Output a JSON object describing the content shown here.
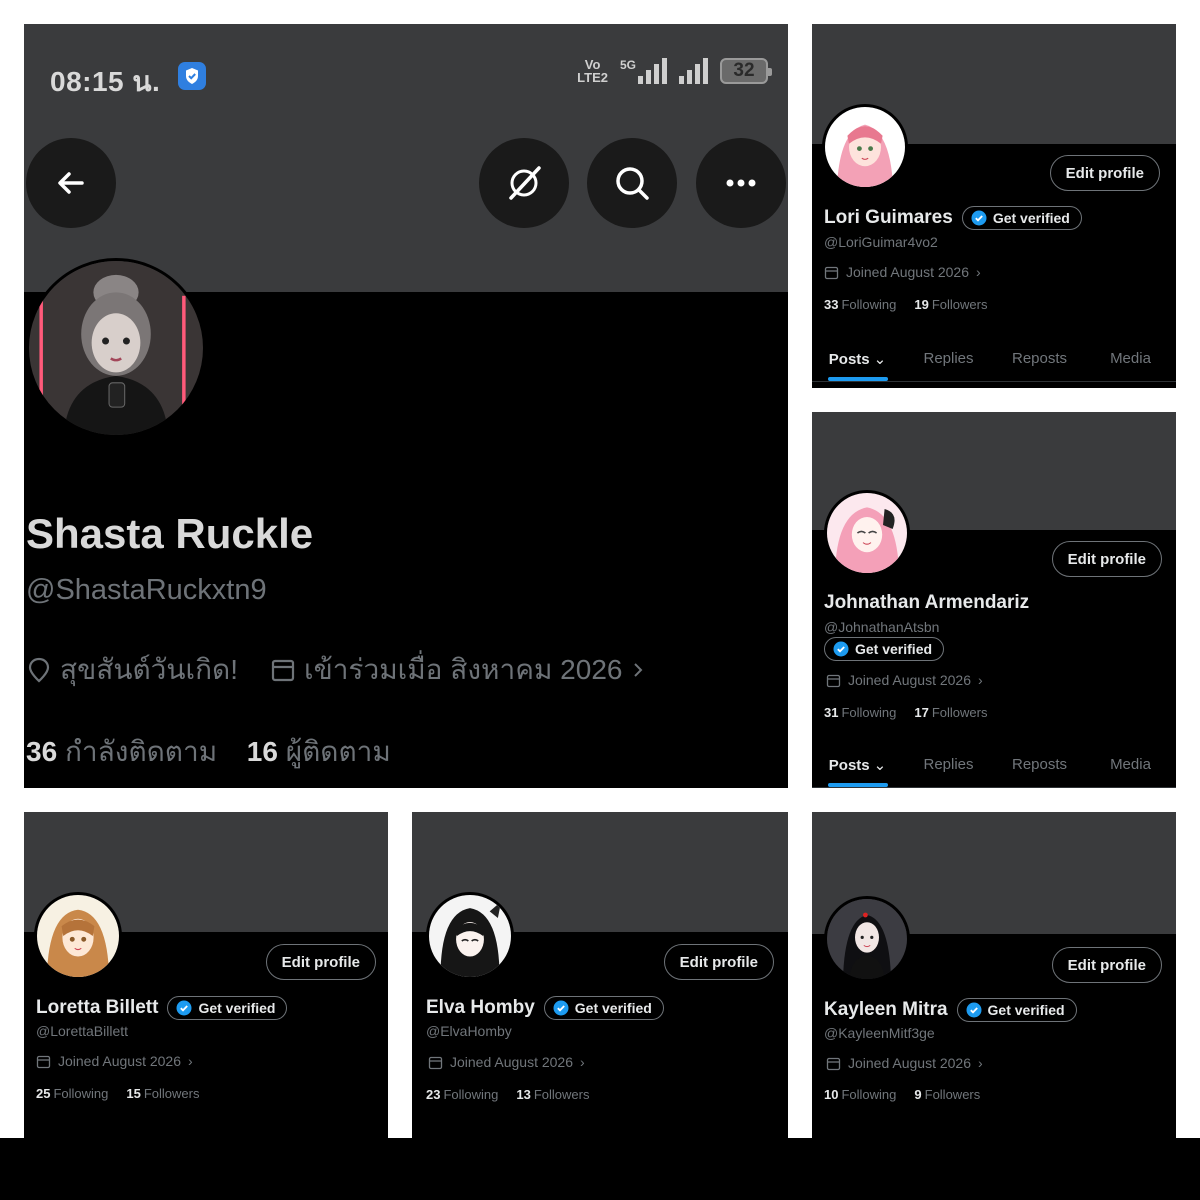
{
  "main": {
    "status_bar": {
      "time": "08:15 น.",
      "volte_top": "Vo",
      "volte_bottom": "LTE2",
      "network": "5G",
      "battery": "32"
    },
    "name": "Shasta Ruckle",
    "handle": "@ShastaRuckxtn9",
    "birthday": "สุขสันต์วันเกิด!",
    "joined": "เข้าร่วมเมื่อ สิงหาคม 2026",
    "following_count": "36",
    "following_label": "กำลังติดตาม",
    "followers_count": "16",
    "followers_label": "ผู้ติดตาม",
    "icons": [
      "back-arrow-icon",
      "grok-icon",
      "search-icon",
      "more-icon",
      "location-icon",
      "calendar-icon",
      "shield-icon"
    ]
  },
  "common": {
    "edit_profile": "Edit profile",
    "get_verified": "Get verified",
    "joined": "Joined August 2026",
    "following_label": "Following",
    "followers_label": "Followers",
    "tabs": [
      "Posts",
      "Replies",
      "Reposts",
      "Media"
    ],
    "accent_color": "#1d9bf0"
  },
  "profiles": [
    {
      "name": "Lori Guimares",
      "handle": "@LoriGuimar4vo2",
      "following": "33",
      "followers": "19"
    },
    {
      "name": "Johnathan Armendariz",
      "handle": "@JohnathanAtsbn",
      "following": "31",
      "followers": "17"
    },
    {
      "name": "Loretta Billett",
      "handle": "@LorettaBillett",
      "following": "25",
      "followers": "15"
    },
    {
      "name": "Elva Homby",
      "handle": "@ElvaHomby",
      "following": "23",
      "followers": "13"
    },
    {
      "name": "Kayleen Mitra",
      "handle": "@KayleenMitf3ge",
      "following": "10",
      "followers": "9"
    }
  ]
}
